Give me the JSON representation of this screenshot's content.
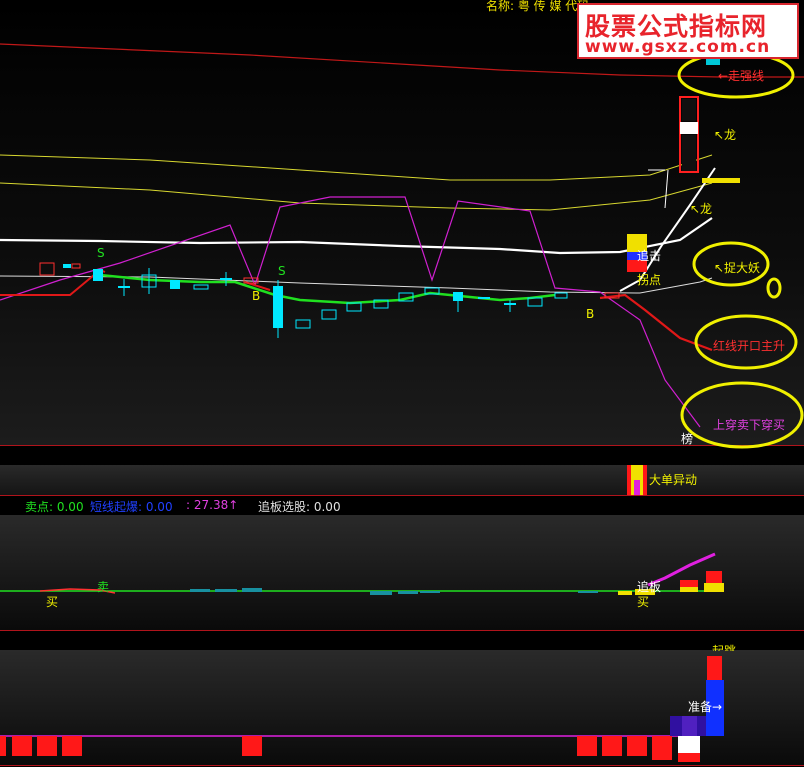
{
  "header": {
    "name_label": "名称: 粤 传 媒 代码"
  },
  "watermark": {
    "title": "股票公式指标网",
    "url": "www.gsxz.com.cn"
  },
  "main_chart": {
    "annotations": {
      "strong_line": "←走强线",
      "dragon_1": "↖龙",
      "dragon_2": "↖龙",
      "catch_demon": "↖捉大妖",
      "red_line": "红线开口主升",
      "cross_line": "上穿卖下穿买",
      "chase": "追击",
      "turn_point": "拐点",
      "bottom": "榜",
      "b_mark_1": "B",
      "b_mark_2": "B",
      "s_mark_1": "S",
      "s_mark_2": "S"
    }
  },
  "volume_panel": {
    "big_order": "大单异动"
  },
  "indicator_header": {
    "sell_point": "卖点: 0.00",
    "short_burst": "短线起爆: 0.00",
    "value": ": 27.38↑",
    "chase_pick": "追板选股: 0.00"
  },
  "indicator_panel": {
    "buy_1": "买",
    "sell_1": "卖",
    "chase_label": "追板",
    "buy_2": "买"
  },
  "bottom_panel": {
    "prepare": "准备→",
    "start": "起跳"
  },
  "colors": {
    "up": "#ff2020",
    "down": "#00e8ff",
    "yellow": "#f0f000",
    "magenta": "#e020e0",
    "green": "#20e020",
    "grid": "#b0141c"
  }
}
